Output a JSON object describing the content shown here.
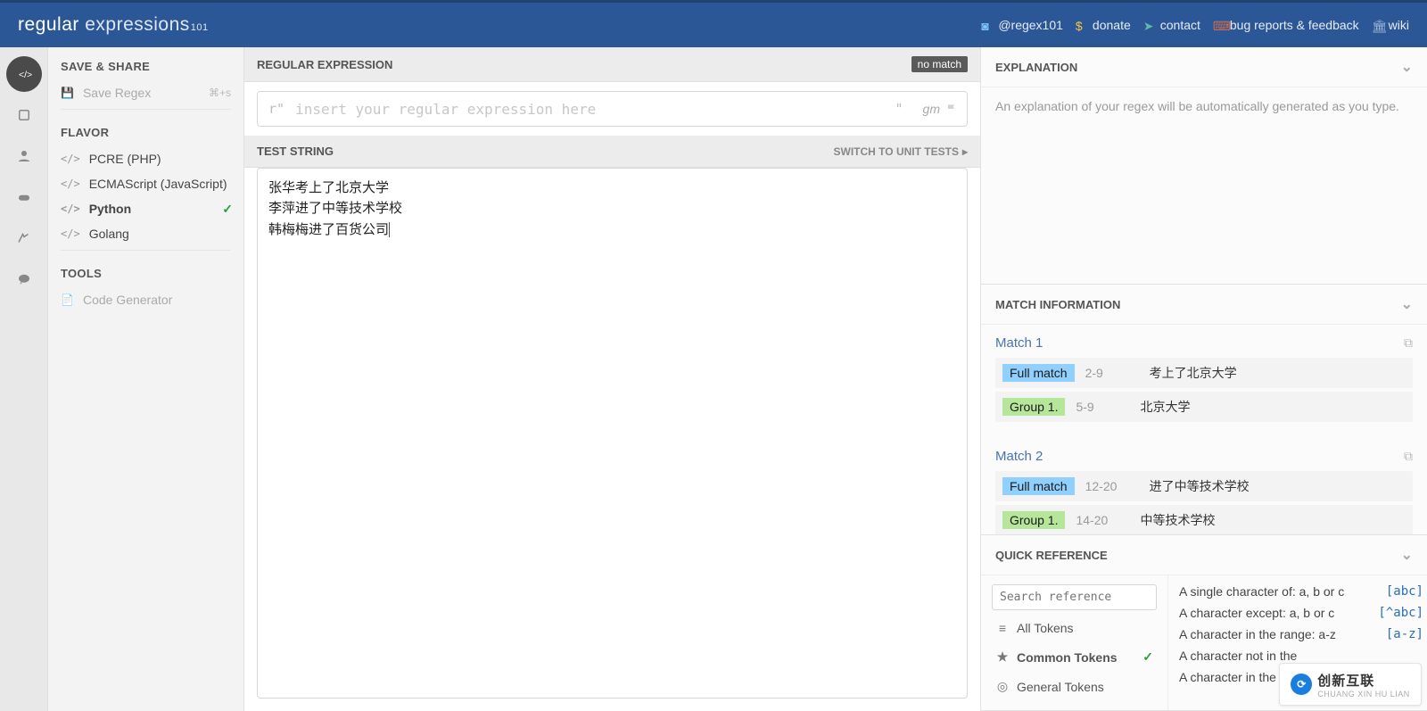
{
  "brand": {
    "word1": "regular",
    "word2": "expressions",
    "suffix": "101"
  },
  "nav": {
    "twitter": "@regex101",
    "donate": "donate",
    "contact": "contact",
    "bugs": "bug reports & feedback",
    "wiki": "wiki"
  },
  "sidebar": {
    "save_share": "SAVE & SHARE",
    "save_regex": "Save Regex",
    "save_shortcut": "⌘+s",
    "flavor": "FLAVOR",
    "flavors": [
      {
        "label": "PCRE (PHP)",
        "selected": false
      },
      {
        "label": "ECMAScript (JavaScript)",
        "selected": false
      },
      {
        "label": "Python",
        "selected": true
      },
      {
        "label": "Golang",
        "selected": false
      }
    ],
    "tools": "TOOLS",
    "code_gen": "Code Generator"
  },
  "center": {
    "regex_label": "REGULAR EXPRESSION",
    "no_match": "no match",
    "delim_left": "r\"",
    "delim_right": "\"",
    "regex_placeholder": "insert your regular expression here",
    "flags": "gm",
    "test_label": "TEST STRING",
    "switch": "SWITCH TO UNIT TESTS",
    "test_value": "张华考上了北京大学\n李萍进了中等技术学校\n韩梅梅进了百货公司"
  },
  "right": {
    "explanation": {
      "title": "EXPLANATION",
      "text": "An explanation of your regex will be automatically generated as you type."
    },
    "match_info": {
      "title": "MATCH INFORMATION",
      "matches": [
        {
          "name": "Match 1",
          "rows": [
            {
              "tag": "Full match",
              "type": "full",
              "range": "2-9",
              "text": "考上了北京大学"
            },
            {
              "tag": "Group 1.",
              "type": "group",
              "range": "5-9",
              "text": "北京大学"
            }
          ]
        },
        {
          "name": "Match 2",
          "rows": [
            {
              "tag": "Full match",
              "type": "full",
              "range": "12-20",
              "text": "进了中等技术学校"
            },
            {
              "tag": "Group 1.",
              "type": "group",
              "range": "14-20",
              "text": "中等技术学校"
            }
          ]
        }
      ]
    },
    "quick_ref": {
      "title": "QUICK REFERENCE",
      "search_placeholder": "Search reference",
      "categories": [
        {
          "label": "All Tokens",
          "icon": "list",
          "selected": false
        },
        {
          "label": "Common Tokens",
          "icon": "star",
          "selected": true
        },
        {
          "label": "General Tokens",
          "icon": "circle",
          "selected": false
        }
      ],
      "items": [
        {
          "desc": "A single character of: a, b or c",
          "token": "[abc]"
        },
        {
          "desc": "A character except: a, b or c",
          "token": "[^abc]"
        },
        {
          "desc": "A character in the range: a-z",
          "token": "[a-z]"
        },
        {
          "desc": "A character not in the",
          "token": ""
        },
        {
          "desc": "A character in the rang",
          "token": ""
        }
      ]
    }
  },
  "watermark": {
    "cn": "创新互联",
    "sub": "CHUANG XIN HU LIAN"
  }
}
